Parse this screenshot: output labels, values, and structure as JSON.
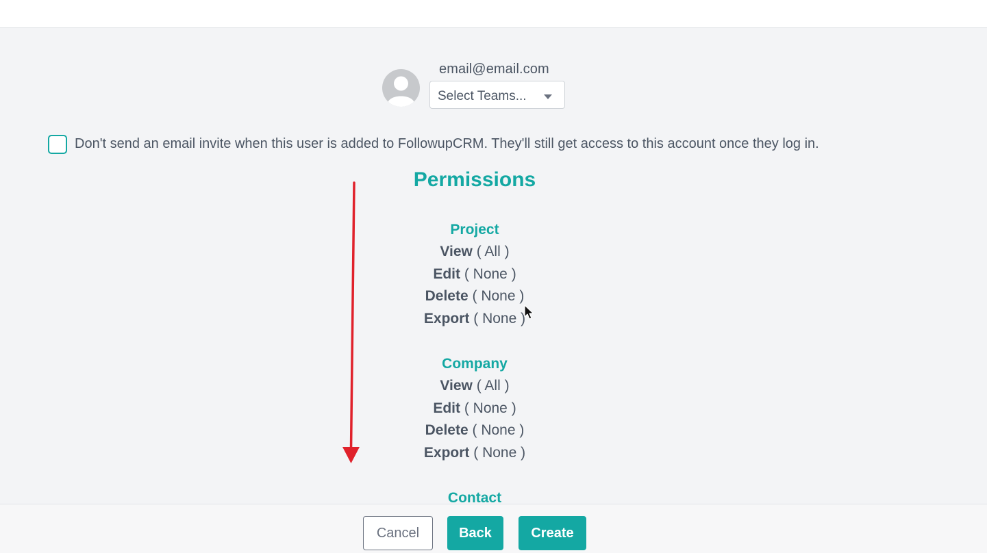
{
  "user": {
    "email": "email@email.com",
    "teams_placeholder": "Select Teams..."
  },
  "invite_option": {
    "checked": false,
    "label": "Don't send an email invite when this user is added to FollowupCRM. They'll still get access to this account once they log in."
  },
  "permissions": {
    "heading": "Permissions",
    "sections": [
      {
        "title": "Project",
        "rows": [
          {
            "action": "View",
            "value": "( All )"
          },
          {
            "action": "Edit",
            "value": "( None )"
          },
          {
            "action": "Delete",
            "value": "( None )"
          },
          {
            "action": "Export",
            "value": "( None )"
          }
        ]
      },
      {
        "title": "Company",
        "rows": [
          {
            "action": "View",
            "value": "( All )"
          },
          {
            "action": "Edit",
            "value": "( None )"
          },
          {
            "action": "Delete",
            "value": "( None )"
          },
          {
            "action": "Export",
            "value": "( None )"
          }
        ]
      },
      {
        "title": "Contact",
        "rows": []
      }
    ]
  },
  "footer": {
    "cancel_label": "Cancel",
    "back_label": "Back",
    "create_label": "Create"
  },
  "colors": {
    "accent": "#14a8a3",
    "annotation_arrow": "#e0212b",
    "text": "#4b5563",
    "background": "#f3f4f6"
  },
  "icons": {
    "avatar": "default-user-avatar-icon",
    "dropdown": "caret-down-icon",
    "annotation": "red-down-arrow",
    "pointer": "mouse-cursor-icon"
  }
}
